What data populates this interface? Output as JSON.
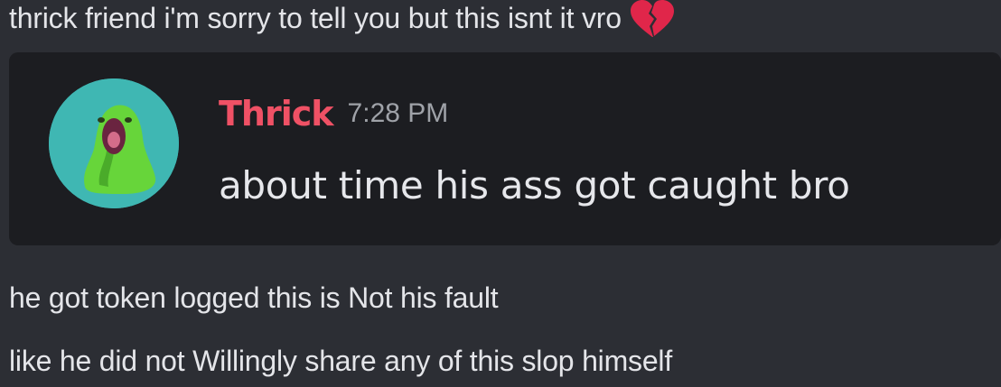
{
  "messages": [
    {
      "text": "thrick friend i'm sorry to tell you but this isnt it vro",
      "emoji": "broken-heart-icon"
    },
    {
      "text": "he got token logged this is Not his fault"
    },
    {
      "text": "like he did not Willingly share any of this slop himself"
    }
  ],
  "embed": {
    "author": "Thrick",
    "timestamp": "7:28 PM",
    "message": "about time his ass got caught bro",
    "author_color": "#ef5165",
    "avatar_bg": "#3fb7b3"
  }
}
